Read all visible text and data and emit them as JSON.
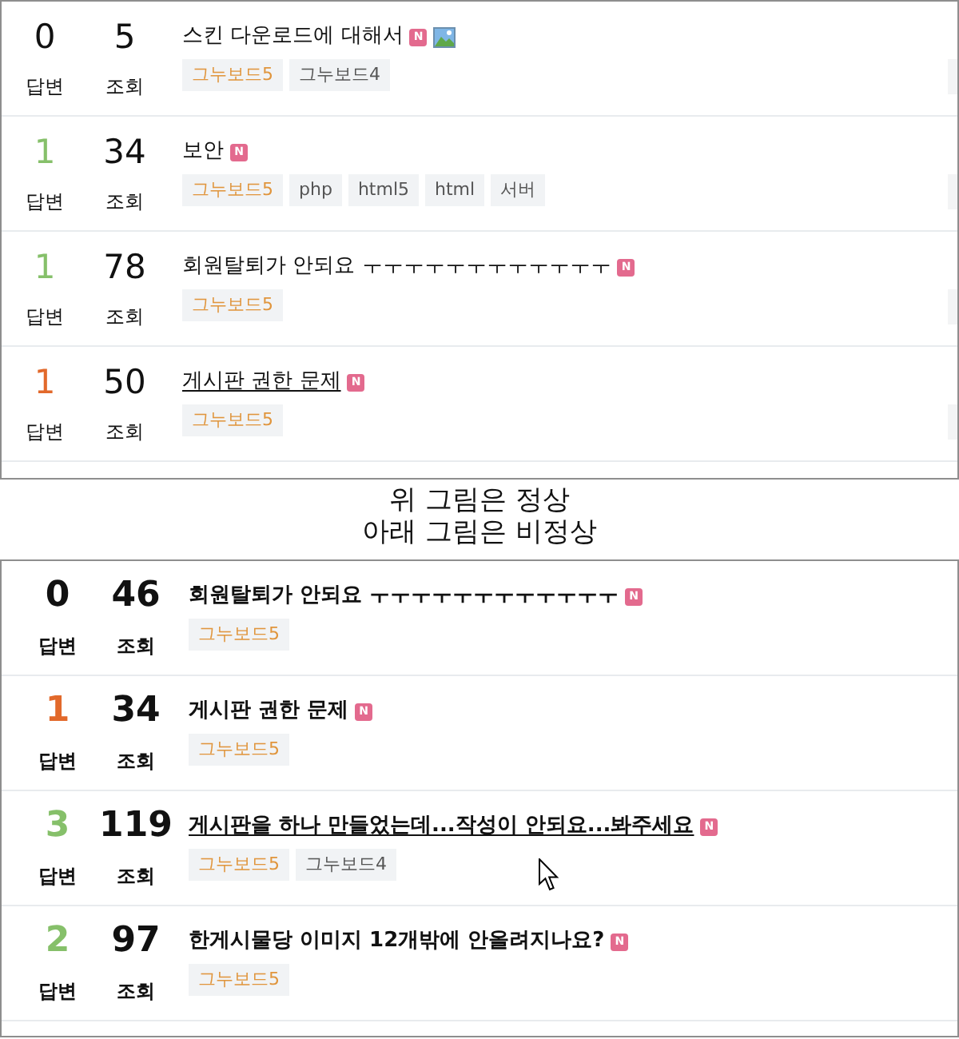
{
  "top_panel": {
    "kind": "regular",
    "clipped_side_tiles": true,
    "rows": [
      {
        "answers": {
          "value": "0",
          "label": "답변",
          "color": "#111111"
        },
        "views": {
          "value": "5",
          "label": "조회"
        },
        "title": "스킨 다운로드에 대해서",
        "hovered": false,
        "badge": "N",
        "image_attached": true,
        "tags": [
          {
            "label": "그누보드5",
            "color": "#e0953c"
          },
          {
            "label": "그누보드4",
            "color": "#555555"
          }
        ]
      },
      {
        "answers": {
          "value": "1",
          "label": "답변",
          "color": "#86c06a"
        },
        "views": {
          "value": "34",
          "label": "조회"
        },
        "title": "보안",
        "hovered": false,
        "badge": "N",
        "image_attached": false,
        "tags": [
          {
            "label": "그누보드5",
            "color": "#e0953c"
          },
          {
            "label": "php",
            "color": "#555555"
          },
          {
            "label": "html5",
            "color": "#555555"
          },
          {
            "label": "html",
            "color": "#555555"
          },
          {
            "label": "서버",
            "color": "#555555"
          }
        ]
      },
      {
        "answers": {
          "value": "1",
          "label": "답변",
          "color": "#86c06a"
        },
        "views": {
          "value": "78",
          "label": "조회"
        },
        "title": "회원탈퇴가 안되요 ㅜㅜㅜㅜㅜㅜㅜㅜㅜㅜㅜㅜ",
        "hovered": false,
        "badge": "N",
        "image_attached": false,
        "tags": [
          {
            "label": "그누보드5",
            "color": "#e0953c"
          }
        ]
      },
      {
        "answers": {
          "value": "1",
          "label": "답변",
          "color": "#e2692b"
        },
        "views": {
          "value": "50",
          "label": "조회"
        },
        "title": "게시판 권한 문제",
        "hovered": true,
        "badge": "N",
        "image_attached": false,
        "tags": [
          {
            "label": "그누보드5",
            "color": "#e0953c"
          }
        ]
      }
    ]
  },
  "caption": {
    "lines": [
      "위 그림은 정상",
      "아래 그림은 비정상"
    ]
  },
  "bottom_panel": {
    "kind": "bold",
    "clipped_side_tiles": false,
    "rows": [
      {
        "answers": {
          "value": "0",
          "label": "답변",
          "color": "#111111"
        },
        "views": {
          "value": "46",
          "label": "조회"
        },
        "title": "회원탈퇴가 안되요 ㅜㅜㅜㅜㅜㅜㅜㅜㅜㅜㅜㅜ",
        "hovered": false,
        "badge": "N",
        "image_attached": false,
        "tags": [
          {
            "label": "그누보드5",
            "color": "#e0953c"
          }
        ]
      },
      {
        "answers": {
          "value": "1",
          "label": "답변",
          "color": "#e2692b"
        },
        "views": {
          "value": "34",
          "label": "조회"
        },
        "title": "게시판 권한 문제",
        "hovered": false,
        "badge": "N",
        "image_attached": false,
        "tags": [
          {
            "label": "그누보드5",
            "color": "#e0953c"
          }
        ]
      },
      {
        "answers": {
          "value": "3",
          "label": "답변",
          "color": "#86c06a"
        },
        "views": {
          "value": "119",
          "label": "조회"
        },
        "title": "게시판을 하나 만들었는데...작성이 안되요...봐주세요",
        "hovered": true,
        "badge": "N",
        "image_attached": false,
        "tags": [
          {
            "label": "그누보드5",
            "color": "#e0953c"
          },
          {
            "label": "그누보드4",
            "color": "#555555"
          }
        ]
      },
      {
        "answers": {
          "value": "2",
          "label": "답변",
          "color": "#86c06a"
        },
        "views": {
          "value": "97",
          "label": "조회"
        },
        "title": "한게시물당 이미지 12개밖에 안올려지나요?",
        "hovered": false,
        "badge": "N",
        "image_attached": false,
        "tags": [
          {
            "label": "그누보드5",
            "color": "#e0953c"
          }
        ]
      }
    ]
  }
}
